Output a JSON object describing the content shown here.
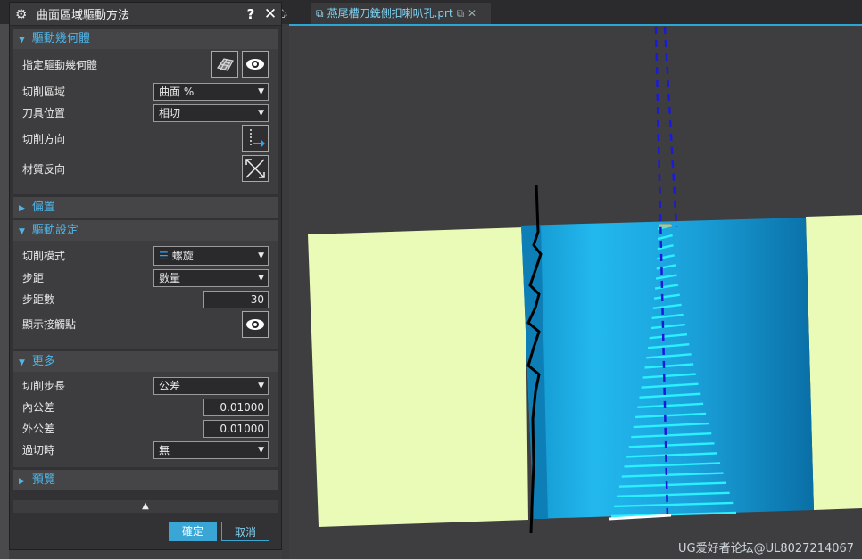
{
  "tabs": {
    "prev_label": "心",
    "active_label": "燕尾槽刀銑側扣喇叭孔.prt"
  },
  "dialog": {
    "title": "曲面區域驅動方法",
    "help_label": "?",
    "close_label": "✕",
    "sections": {
      "drive_geometry": {
        "title": "驅動幾何體",
        "specify_label": "指定驅動幾何體",
        "cut_area_label": "切削區域",
        "cut_area_value": "曲面 %",
        "tool_position_label": "刀具位置",
        "tool_position_value": "相切",
        "cut_direction_label": "切削方向",
        "material_reverse_label": "材質反向"
      },
      "offset": {
        "title": "偏置"
      },
      "drive_settings": {
        "title": "驅動設定",
        "cut_mode_label": "切削模式",
        "cut_mode_value": "螺旋",
        "stepover_label": "步距",
        "stepover_value": "數量",
        "step_count_label": "步距數",
        "step_count_value": "30",
        "show_contact_label": "顯示接觸點"
      },
      "more": {
        "title": "更多",
        "cut_step_label": "切削步長",
        "cut_step_value": "公差",
        "intol_label": "內公差",
        "intol_value": "0.01000",
        "outtol_label": "外公差",
        "outtol_value": "0.01000",
        "overcut_label": "過切時",
        "overcut_value": "無"
      },
      "preview": {
        "title": "預覽"
      }
    },
    "collapse_label": "▲",
    "ok_label": "確定",
    "cancel_label": "取消"
  },
  "watermark": "UG爱好者论坛@UL8027214067",
  "colors": {
    "accent": "#2aa7d6",
    "part_face": "#e9fbb6",
    "cylinder": "#1aa6e0",
    "toolpath": "#2af0ff",
    "tool_axis": "#1a1ad8"
  }
}
